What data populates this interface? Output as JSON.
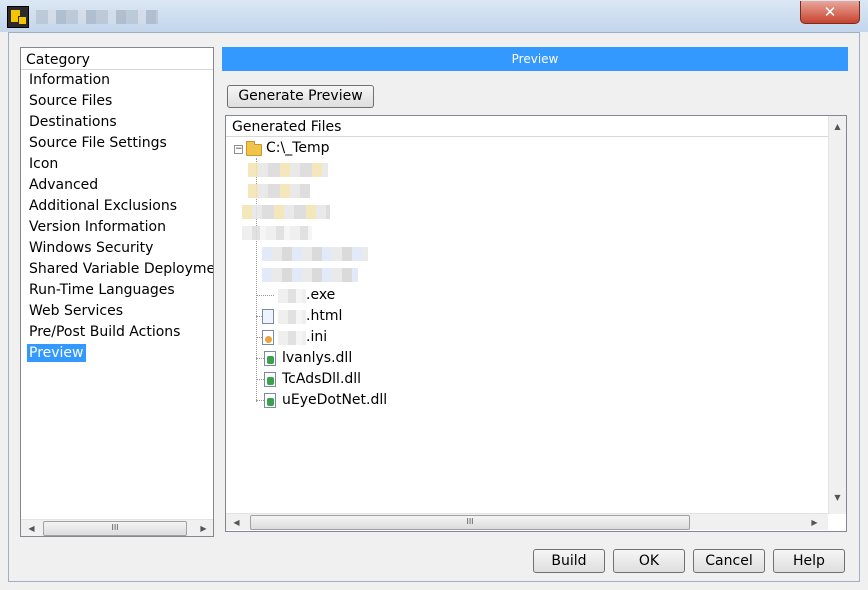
{
  "category": {
    "header": "Category",
    "items": [
      {
        "label": "Information"
      },
      {
        "label": "Source Files"
      },
      {
        "label": "Destinations"
      },
      {
        "label": "Source File Settings"
      },
      {
        "label": "Icon"
      },
      {
        "label": "Advanced"
      },
      {
        "label": "Additional Exclusions"
      },
      {
        "label": "Version Information"
      },
      {
        "label": "Windows Security"
      },
      {
        "label": "Shared Variable Deploymen"
      },
      {
        "label": "Run-Time Languages"
      },
      {
        "label": "Web Services"
      },
      {
        "label": "Pre/Post Build Actions"
      },
      {
        "label": "Preview",
        "selected": true
      }
    ],
    "scroll_thumb": "III"
  },
  "preview": {
    "bar_title": "Preview",
    "generate_button": "Generate Preview",
    "files_header": "Generated Files",
    "root": "C:\\_Temp",
    "files": [
      {
        "label": ".exe",
        "icon": "blank"
      },
      {
        "label": ".html",
        "icon": "html-file-icon"
      },
      {
        "label": ".ini",
        "icon": "ini-file-icon"
      },
      {
        "label": "lvanlys.dll",
        "icon": "dll-file-icon"
      },
      {
        "label": "TcAdsDll.dll",
        "icon": "dll-file-icon"
      },
      {
        "label": "uEyeDotNet.dll",
        "icon": "dll-file-icon"
      }
    ],
    "scroll_thumb": "III"
  },
  "buttons": {
    "build": "Build",
    "ok": "OK",
    "cancel": "Cancel",
    "help": "Help"
  },
  "window": {
    "close_glyph": "✕"
  }
}
